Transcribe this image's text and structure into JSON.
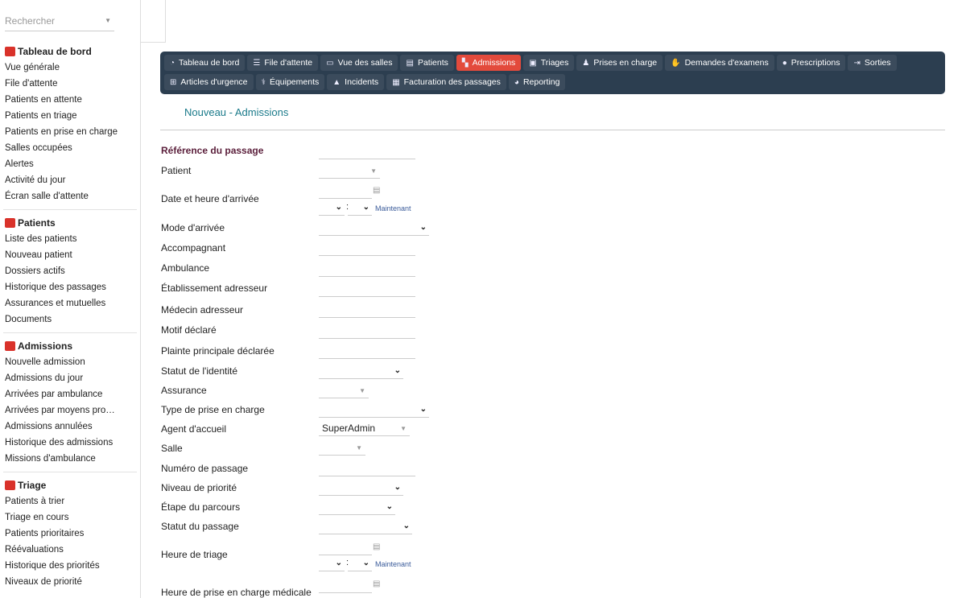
{
  "search": {
    "placeholder": "Rechercher"
  },
  "sidebar": {
    "sections": [
      {
        "title": "Tableau de bord",
        "icon": "dashboard-icon",
        "color": "#d9322a",
        "items": [
          "Vue générale",
          "File d'attente",
          "Patients en attente",
          "Patients en triage",
          "Patients en prise en charge",
          "Salles occupées",
          "Alertes",
          "Activité du jour",
          "Écran salle d'attente"
        ]
      },
      {
        "title": "Patients",
        "icon": "id-card-icon",
        "color": "#d9322a",
        "items": [
          "Liste des patients",
          "Nouveau patient",
          "Dossiers actifs",
          "Historique des passages",
          "Assurances et mutuelles",
          "Documents"
        ]
      },
      {
        "title": "Admissions",
        "icon": "door-icon",
        "color": "#d9322a",
        "items": [
          "Nouvelle admission",
          "Admissions du jour",
          "Arrivées par ambulance",
          "Arrivées par moyens pro…",
          "Admissions annulées",
          "Historique des admissions",
          "Missions d'ambulance"
        ]
      },
      {
        "title": "Triage",
        "icon": "clipboard-icon",
        "color": "#d9322a",
        "items": [
          "Patients à trier",
          "Triage en cours",
          "Patients prioritaires",
          "Réévaluations",
          "Historique des priorités",
          "Niveaux de priorité"
        ]
      }
    ]
  },
  "menu": {
    "row1": [
      {
        "label": "Tableau de bord",
        "icon": "gauge-icon",
        "glyph": "◔"
      },
      {
        "label": "File d'attente",
        "icon": "list-icon",
        "glyph": "☰"
      },
      {
        "label": "Vue des salles",
        "icon": "bed-icon",
        "glyph": "▭"
      },
      {
        "label": "Patients",
        "icon": "id-card-icon",
        "glyph": "▤"
      },
      {
        "label": "Admissions",
        "icon": "door-icon",
        "glyph": "▚",
        "active": true
      },
      {
        "label": "Triages",
        "icon": "clipboard-icon",
        "glyph": "▣"
      },
      {
        "label": "Prises en charge",
        "icon": "user-doctor-icon",
        "glyph": "♟"
      },
      {
        "label": "Demandes d'examens",
        "icon": "hand-icon",
        "glyph": "✋"
      },
      {
        "label": "Prescriptions",
        "icon": "pills-icon",
        "glyph": "●"
      },
      {
        "label": "Sorties",
        "icon": "sign-out-icon",
        "glyph": "⇥"
      }
    ],
    "row2": [
      {
        "label": "Articles d'urgence",
        "icon": "sitemap-icon",
        "glyph": "⊞"
      },
      {
        "label": "Équipements",
        "icon": "stethoscope-icon",
        "glyph": "⚕"
      },
      {
        "label": "Incidents",
        "icon": "warning-icon",
        "glyph": "▲"
      },
      {
        "label": "Facturation des passages",
        "icon": "invoice-icon",
        "glyph": "▦"
      },
      {
        "label": "Reporting",
        "icon": "pie-chart-icon",
        "glyph": "◕"
      }
    ],
    "active_color": "#e34a3c",
    "bar_color": "#2c3e50"
  },
  "page": {
    "title": "Nouveau - Admissions"
  },
  "form": {
    "section": "Référence du passage",
    "fields": {
      "patient": "Patient",
      "date_arrivee": "Date et heure d'arrivée",
      "mode_arrivee": "Mode d'arrivée",
      "accompagnant": "Accompagnant",
      "ambulance": "Ambulance",
      "etablissement": "Établissement adresseur",
      "medecin": "Médecin adresseur",
      "motif": "Motif déclaré",
      "plainte": "Plainte principale déclarée",
      "statut_identite": "Statut de l'identité",
      "assurance": "Assurance",
      "type_prise": "Type de prise en charge",
      "agent": "Agent d'accueil",
      "salle": "Salle",
      "numero": "Numéro de passage",
      "niveau": "Niveau de priorité",
      "etape": "Étape du parcours",
      "statut_passage": "Statut du passage",
      "heure_triage": "Heure de triage",
      "heure_prise": "Heure de prise en charge médicale"
    },
    "agent_value": "SuperAdmin",
    "now_label": "Maintenant"
  }
}
